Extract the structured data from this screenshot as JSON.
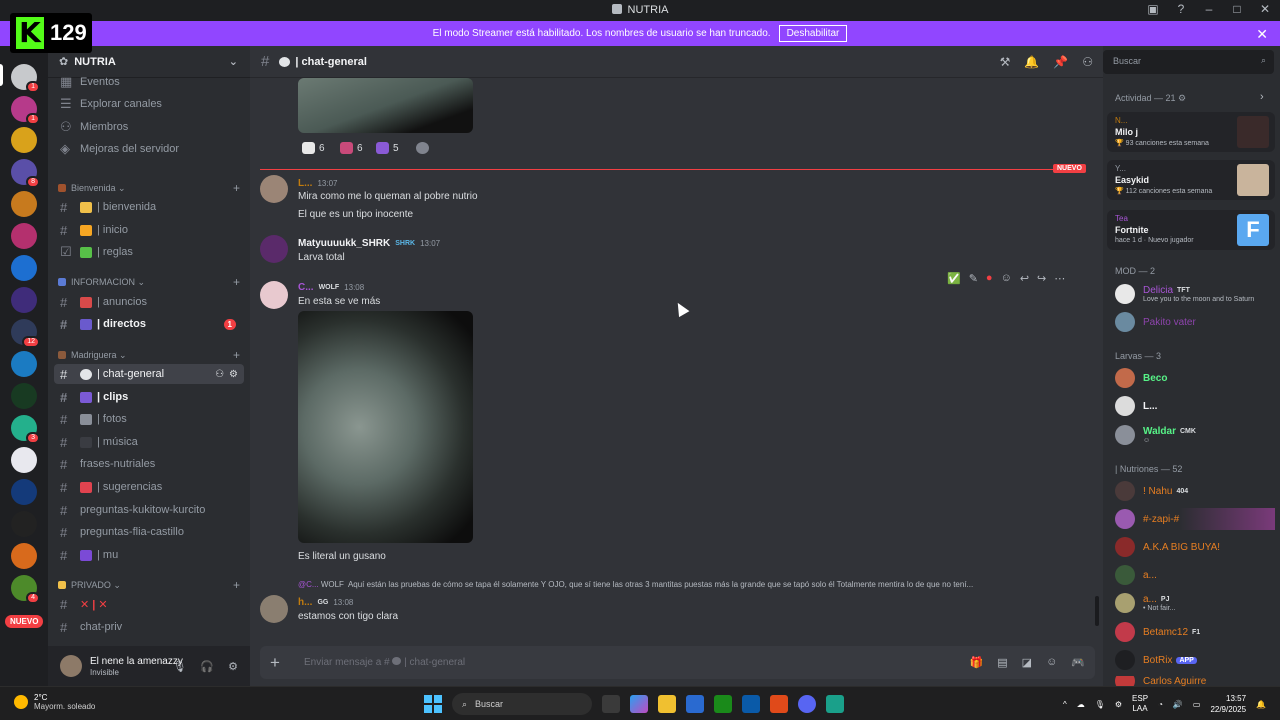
{
  "overlay": {
    "k_number": "129"
  },
  "window": {
    "title": "NUTRIA"
  },
  "banner": {
    "text": "El modo Streamer está habilitado. Los nombres de usuario se han truncado.",
    "button": "Deshabilitar"
  },
  "guilds": {
    "new_label": "NUEVO",
    "badges": [
      "1",
      "1",
      "8",
      "12",
      "3",
      "4"
    ]
  },
  "server": {
    "name": "NUTRIA",
    "top_items": [
      "Eventos",
      "Explorar canales",
      "Miembros",
      "Mejoras del servidor"
    ],
    "categories": [
      {
        "name": "Bienvenida",
        "channels": [
          "bienvenida",
          "inicio",
          "reglas"
        ]
      },
      {
        "name": "INFORMACION",
        "channels": [
          "anuncios",
          "directos"
        ]
      },
      {
        "name": "Madriguera",
        "channels": [
          "chat-general",
          "clips",
          "fotos",
          "música",
          "frases-nutriales",
          "sugerencias",
          "preguntas-kukitow-kurcito",
          "preguntas-flia-castillo",
          "mu"
        ]
      },
      {
        "name": "PRIVADO",
        "channels": [
          "✕ | ✕",
          "chat-priv"
        ]
      }
    ],
    "directos_mentions": "1",
    "sep": "|"
  },
  "user": {
    "name": "El nene la amenazzy",
    "status": "Invisible"
  },
  "channel": {
    "name": "chat-general",
    "sep": "|"
  },
  "messages": {
    "reactions": [
      "6",
      "6",
      "5"
    ],
    "new_label": "NUEVO",
    "m1": {
      "author": "L...",
      "time": "13:07",
      "lines": [
        "Mira como me lo queman al pobre nutrio",
        "El que es un tipo inocente"
      ]
    },
    "m2": {
      "author": "Matyuuuukk_SHRK",
      "tag": "SHRK",
      "time": "13:07",
      "text": "Larva total"
    },
    "m3": {
      "author": "C...",
      "tag": "WOLF",
      "time": "13:08",
      "text": "En esta se ve más",
      "after": "Es literal un gusano"
    },
    "m4": {
      "reply_author": "@C...",
      "reply_tag": "WOLF",
      "reply_text": "Aquí están las pruebas de cómo se tapa él solamente Y OJO, que sí tiene las otras 3 mantitas puestas más la grande que se tapó solo él Totalmente mentira lo de que no tení...",
      "author": "h...",
      "tag": "GG",
      "time": "13:08",
      "text": "estamos con tigo clara"
    }
  },
  "composer": {
    "placeholder": "Enviar mensaje a #",
    "channel": "| chat-general"
  },
  "search": {
    "placeholder": "Buscar"
  },
  "members": {
    "activity_header": "Actividad — 21",
    "activities": [
      {
        "user": "N...",
        "name": "Milo j",
        "detail": "93 canciones esta semana"
      },
      {
        "user": "Y...",
        "name": "Easykid",
        "detail": "112 canciones esta semana"
      },
      {
        "user": "Tea",
        "name": "Fortnite",
        "detail": "hace 1 d · Nuevo jugador"
      }
    ],
    "mod_header": "MOD — 2",
    "mods": [
      {
        "name": "Delicia",
        "tag": "TFT",
        "sub": "Love you to the moon and to Saturn",
        "color": "#a855d6"
      },
      {
        "name": "Pakito vater",
        "color": "#8e44ad"
      }
    ],
    "larvas_header": "Larvas — 3",
    "larvas": [
      {
        "name": "Beco",
        "color": "#57f287"
      },
      {
        "name": "L...",
        "color": "#f2f3f5"
      },
      {
        "name": "Waldar",
        "tag": "CMK",
        "color": "#57f287"
      }
    ],
    "nutriones_header": "| Nutriones — 52",
    "nutriones": [
      {
        "name": "! Nahu",
        "tag": "404",
        "color": "#e67e22"
      },
      {
        "name": "#-zapi-#",
        "color": "#e67e22"
      },
      {
        "name": "A.K.A BIG BUYA!",
        "color": "#e67e22"
      },
      {
        "name": "a...",
        "color": "#e67e22"
      },
      {
        "name": "a...",
        "tag": "PJ",
        "sub": "• Not fair...",
        "color": "#e67e22"
      },
      {
        "name": "Betamc12",
        "tag": "F1",
        "color": "#e67e22"
      },
      {
        "name": "BotRix",
        "tag": "APP",
        "color": "#e67e22"
      },
      {
        "name": "Carlos Aguirre",
        "color": "#e67e22"
      }
    ]
  },
  "taskbar": {
    "temp": "2°C",
    "weather": "Mayorm. soleado",
    "search": "Buscar",
    "lang1": "ESP",
    "lang2": "LAA",
    "time": "13:57",
    "date": "22/9/2025"
  }
}
